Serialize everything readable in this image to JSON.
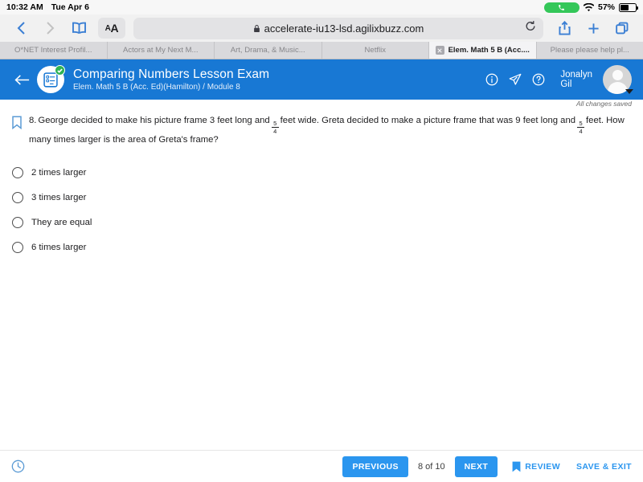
{
  "status_bar": {
    "time": "10:32 AM",
    "date": "Tue Apr 6",
    "call_icon": "phone-icon",
    "wifi_icon": "wifi-icon",
    "battery_percent": "57%",
    "battery_level": 57
  },
  "browser": {
    "back_icon": "chevron-left-icon",
    "forward_icon": "chevron-right-icon",
    "bookmarks_icon": "book-icon",
    "text_size_small": "A",
    "text_size_large": "A",
    "lock_icon": "lock-icon",
    "url": "accelerate-iu13-lsd.agilixbuzz.com",
    "reload_icon": "reload-icon",
    "share_icon": "share-icon",
    "new_tab_icon": "plus-icon",
    "tabs_icon": "tabs-overview-icon",
    "tabs": [
      {
        "label": "O*NET Interest Profil...",
        "active": false
      },
      {
        "label": "Actors at My Next M...",
        "active": false
      },
      {
        "label": "Art, Drama, & Music...",
        "active": false
      },
      {
        "label": "Netflix",
        "active": false
      },
      {
        "label": "Elem. Math 5 B (Acc....",
        "active": true
      },
      {
        "label": "Please please help pl...",
        "active": false
      }
    ]
  },
  "app_header": {
    "back_icon": "arrow-left-icon",
    "exam_icon": "exam-clipboard-icon",
    "status_check_icon": "check-icon",
    "title": "Comparing Numbers Lesson Exam",
    "subtitle": "Elem. Math 5 B (Acc. Ed)(Hamilton) / Module 8",
    "info_icon": "info-icon",
    "send_icon": "paper-plane-icon",
    "help_icon": "question-mark-icon",
    "user_name_line1": "Jonalyn",
    "user_name_line2": "Gil",
    "avatar_icon": "avatar-icon",
    "caret_icon": "caret-down-icon",
    "accent_color": "#1878d4"
  },
  "save_status": "All changes saved",
  "question": {
    "flag_icon": "bookmark-flag-icon",
    "number": "8.",
    "part1": "George decided to make his picture frame 3 feet long and",
    "fraction1": {
      "numerator": "5",
      "denominator": "4"
    },
    "part2": "feet wide. Greta decided to make a picture frame that was 9 feet long and",
    "fraction2": {
      "numerator": "5",
      "denominator": "4"
    },
    "part3": "feet. How many times larger is the area of Greta's frame?",
    "options": [
      {
        "label": "2 times larger",
        "selected": false
      },
      {
        "label": "3 times larger",
        "selected": false
      },
      {
        "label": "They are equal",
        "selected": false
      },
      {
        "label": "6 times larger",
        "selected": false
      }
    ]
  },
  "bottom_bar": {
    "timer_icon": "clock-icon",
    "previous_label": "PREVIOUS",
    "page_indicator": "8 of 10",
    "next_label": "NEXT",
    "review_icon": "bookmark-filled-icon",
    "review_label": "REVIEW",
    "save_exit_label": "SAVE & EXIT",
    "button_color": "#2b96ef"
  }
}
